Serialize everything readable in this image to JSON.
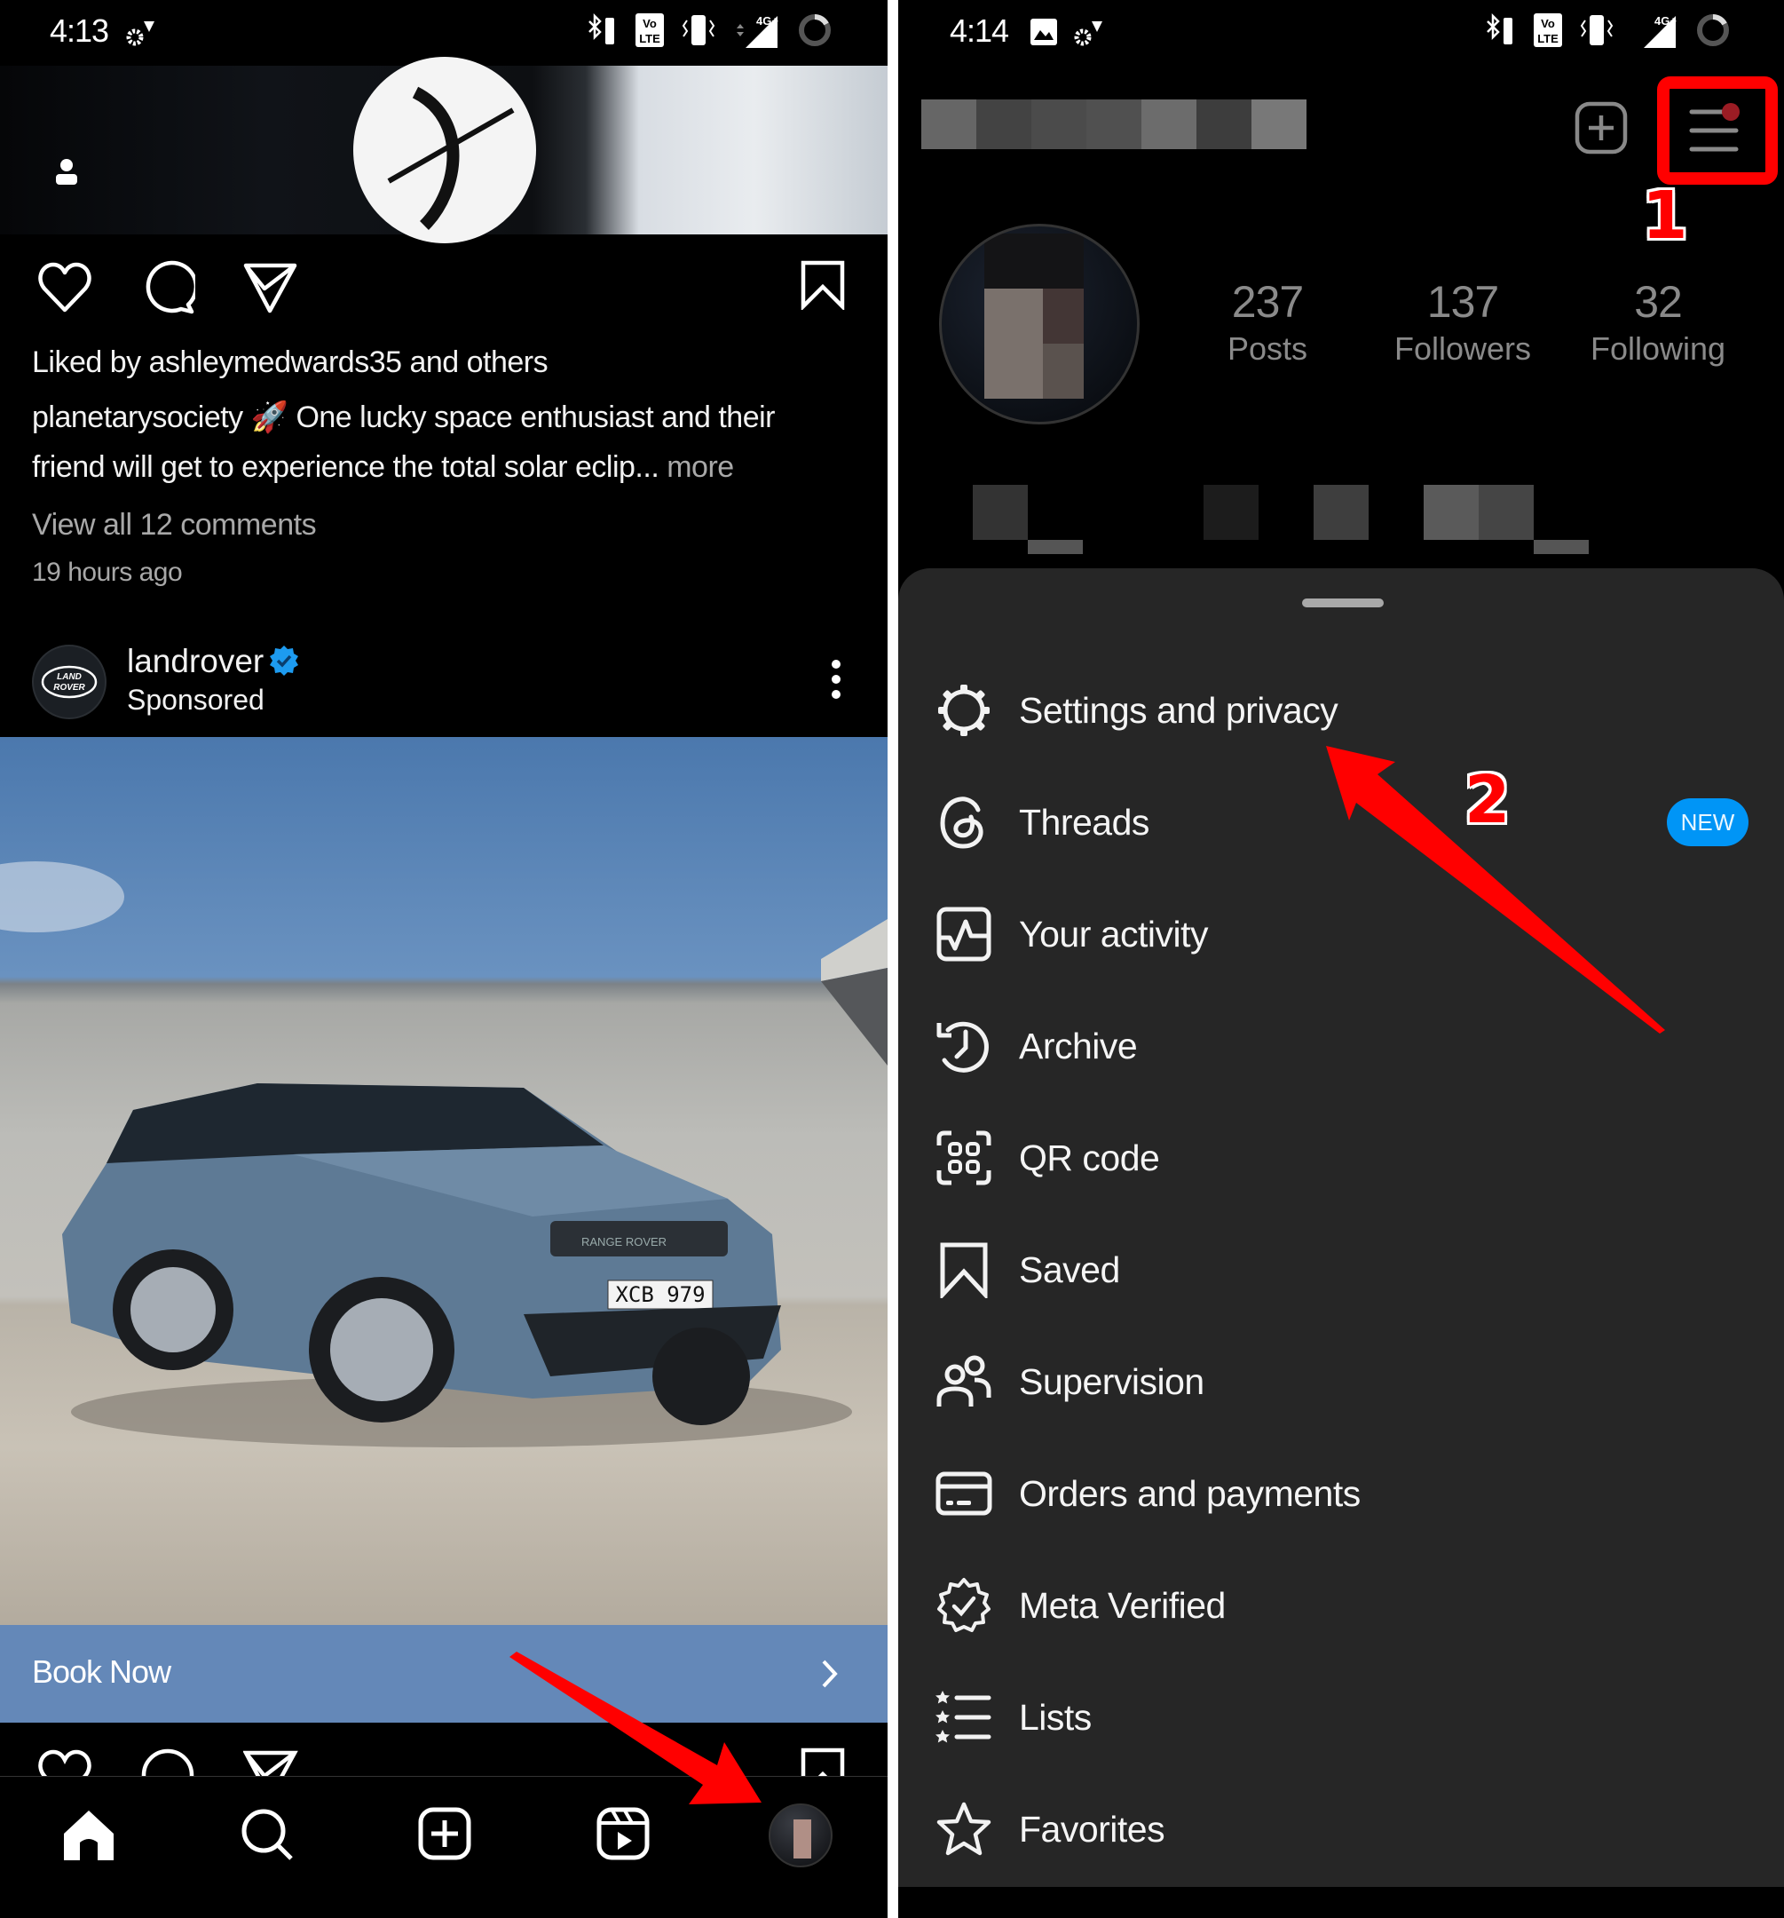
{
  "left_screen": {
    "status_bar": {
      "time": "4:13",
      "icons": [
        "settings-notification-icon",
        "bluetooth-battery-icon",
        "volte-icon",
        "vibrate-icon",
        "4g-signal-icon",
        "battery-ring-icon"
      ]
    },
    "post": {
      "actions": [
        "like-icon",
        "comment-icon",
        "share-icon",
        "save-icon"
      ],
      "liked_by": "Liked by ashleymedwards35 and others",
      "caption_user": "planetarysociety",
      "caption_emoji": "🚀",
      "caption_text_line1": "One lucky space enthusiast and their",
      "caption_text_line2": "friend will get to experience the total solar eclip...",
      "more_label": "more",
      "view_comments": "View all 12 comments",
      "timestamp": "19 hours ago"
    },
    "ad": {
      "username": "landrover",
      "verified": true,
      "sponsored_label": "Sponsored",
      "logo_text_1": "LAND",
      "logo_text_2": "ROVER",
      "plate": "XCB 979",
      "grille_text": "RANGE ROVER",
      "cta_label": "Book Now"
    },
    "bottom_nav": [
      "home",
      "search",
      "create",
      "reels",
      "profile"
    ]
  },
  "right_screen": {
    "status_bar": {
      "time": "4:14"
    },
    "profile": {
      "stats": [
        {
          "value": "237",
          "label": "Posts"
        },
        {
          "value": "137",
          "label": "Followers"
        },
        {
          "value": "32",
          "label": "Following"
        }
      ]
    },
    "menu": {
      "items": [
        {
          "label": "Settings and privacy",
          "icon": "settings-icon"
        },
        {
          "label": "Threads",
          "icon": "threads-icon",
          "badge": "NEW"
        },
        {
          "label": "Your activity",
          "icon": "activity-icon"
        },
        {
          "label": "Archive",
          "icon": "archive-icon"
        },
        {
          "label": "QR code",
          "icon": "qr-code-icon"
        },
        {
          "label": "Saved",
          "icon": "saved-icon"
        },
        {
          "label": "Supervision",
          "icon": "supervision-icon"
        },
        {
          "label": "Orders and payments",
          "icon": "card-icon"
        },
        {
          "label": "Meta Verified",
          "icon": "verified-badge-icon"
        },
        {
          "label": "Lists",
          "icon": "lists-icon"
        },
        {
          "label": "Favorites",
          "icon": "star-icon"
        }
      ]
    }
  },
  "annotations": {
    "step1": "1",
    "step2": "2",
    "color": "#ff0000"
  },
  "colors": {
    "sheet_bg": "#262626",
    "cta_bg": "#6488b8",
    "new_badge": "#0095f6",
    "verified": "#1d9bf0"
  }
}
